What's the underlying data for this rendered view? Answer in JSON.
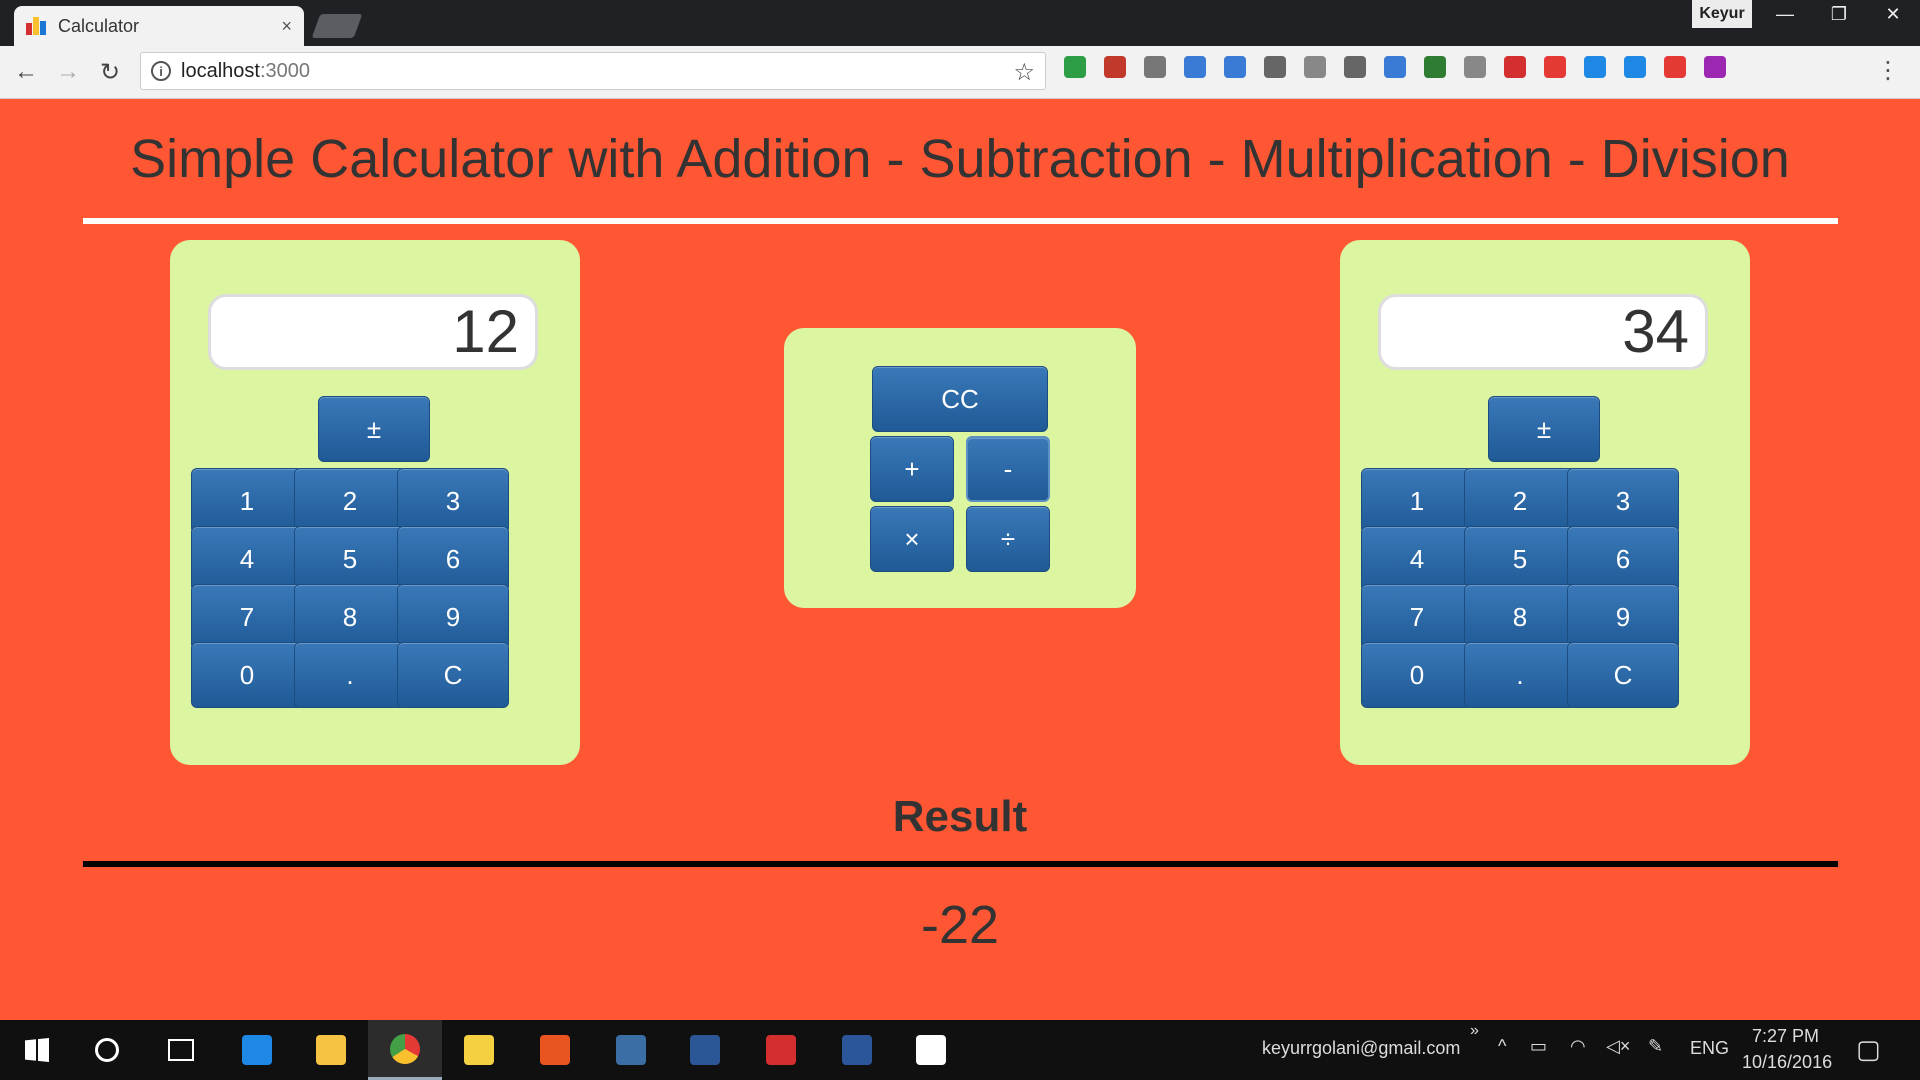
{
  "browser": {
    "tab_title": "Calculator",
    "tab_close": "×",
    "profile_name": "Keyur",
    "window_controls": [
      "—",
      "❐",
      "✕"
    ],
    "url_host": "localhost",
    "url_port": ":3000",
    "extensions": [
      {
        "name": "extension-green-icon",
        "color": "#2e9e46"
      },
      {
        "name": "pdf-icon",
        "color": "#c0392b"
      },
      {
        "name": "stack-icon",
        "color": "#777777"
      },
      {
        "name": "shape-icon",
        "color": "#3a7bd5"
      },
      {
        "name": "megaphone-icon",
        "color": "#3a7bd5"
      },
      {
        "name": "pen-icon",
        "color": "#666666"
      },
      {
        "name": "angular-icon",
        "color": "#888888"
      },
      {
        "name": "letter-a-icon",
        "color": "#666666"
      },
      {
        "name": "window-icon",
        "color": "#3a7bd5"
      },
      {
        "name": "bw-icon",
        "color": "#2e7d32"
      },
      {
        "name": "shield-icon",
        "color": "#888888"
      },
      {
        "name": "bookmark-icon",
        "color": "#d32f2f"
      },
      {
        "name": "abp-icon",
        "color": "#e53935"
      },
      {
        "name": "photo-icon",
        "color": "#1e88e5"
      },
      {
        "name": "toggle-icon",
        "color": "#1e88e5"
      },
      {
        "name": "star-box-icon",
        "color": "#e53935"
      },
      {
        "name": "color-wheel-icon",
        "color": "#9c27b0"
      }
    ]
  },
  "page": {
    "heading": "Simple Calculator with Addition - Subtraction - Multiplication - Division",
    "left_calc": {
      "display": "12",
      "sign": "±",
      "keys": [
        "1",
        "2",
        "3",
        "4",
        "5",
        "6",
        "7",
        "8",
        "9",
        "0",
        ".",
        "C"
      ]
    },
    "right_calc": {
      "display": "34",
      "sign": "±",
      "keys": [
        "1",
        "2",
        "3",
        "4",
        "5",
        "6",
        "7",
        "8",
        "9",
        "0",
        ".",
        "C"
      ]
    },
    "ops": {
      "clear": "CC",
      "add": "+",
      "subtract": "-",
      "multiply": "×",
      "divide": "÷"
    },
    "result_title": "Result",
    "result_value": "-22"
  },
  "taskbar": {
    "email": "keyurrgolani@gmail.com",
    "chevron": "»",
    "language": "ENG",
    "time": "7:27 PM",
    "date": "10/16/2016",
    "apps": [
      "start",
      "cortana",
      "task-view",
      "edge",
      "file-explorer",
      "chrome",
      "paint",
      "ubuntu",
      "mysql-workbench",
      "powershell",
      "acrobat",
      "word",
      "photos"
    ],
    "colors": {
      "edge": "#1e88e5",
      "file-explorer": "#f6c342",
      "chrome": "#e53935",
      "paint": "#f5d142",
      "ubuntu": "#e95420",
      "mysql-workbench": "#3b6ea5",
      "powershell": "#2b5797",
      "acrobat": "#d32f2f",
      "word": "#2b579a",
      "photos": "#ffffff"
    }
  }
}
